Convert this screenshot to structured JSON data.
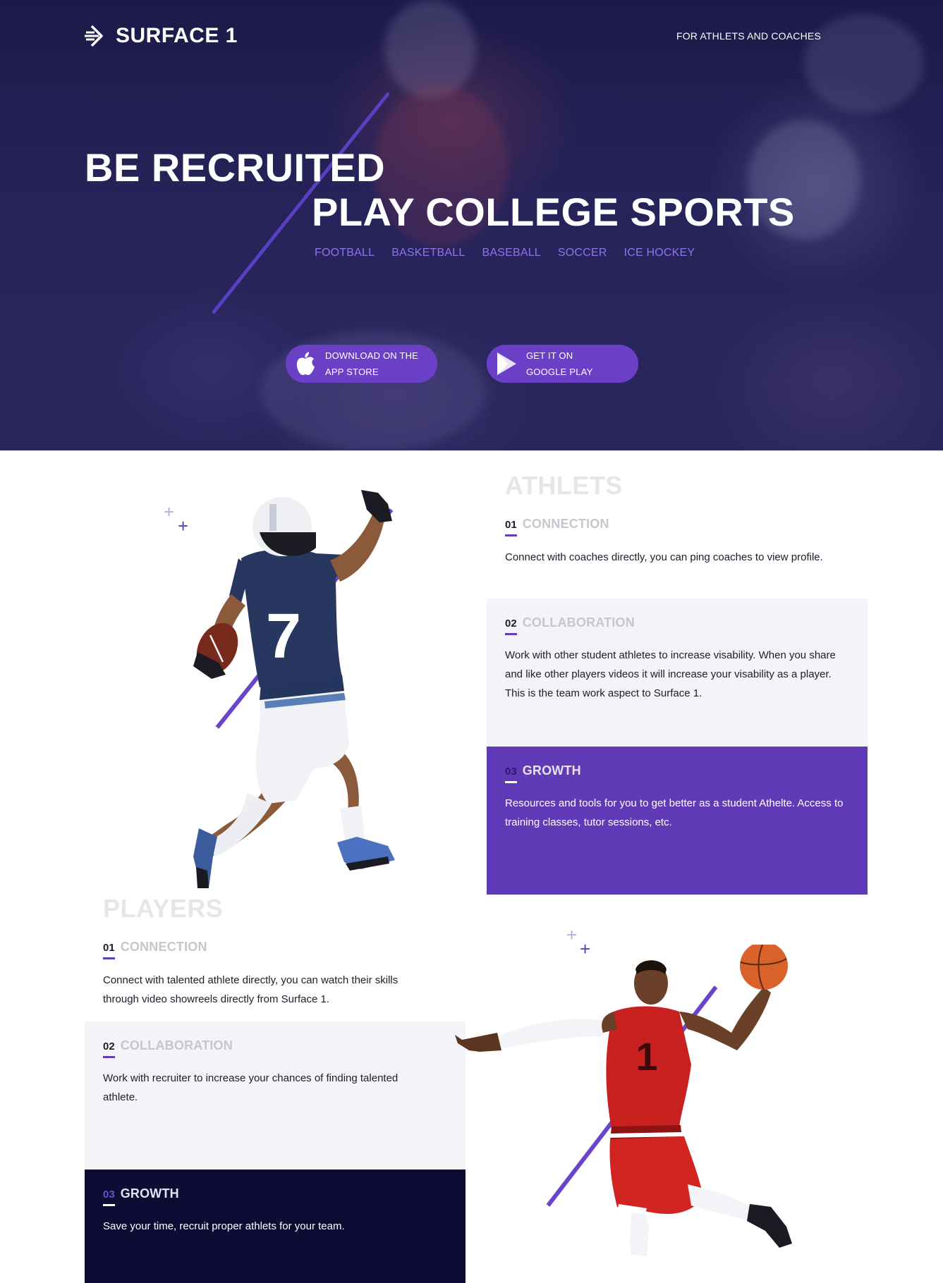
{
  "header": {
    "logo_text": "SURFACE 1",
    "top_link": "FOR ATHLETS AND COACHES"
  },
  "hero": {
    "line1": "BE RECRUITED",
    "line2": "PLAY COLLEGE SPORTS",
    "sports": [
      "FOOTBALL",
      "BASKETBALL",
      "BASEBALL",
      "SOCCER",
      "ICE HOCKEY"
    ],
    "appstore": {
      "line1": "DOWNLOAD ON THE",
      "line2": "APP STORE",
      "icon": "apple-icon"
    },
    "googleplay": {
      "line1": "GET IT ON",
      "line2": "GOOGLE PLAY",
      "icon": "play-icon"
    }
  },
  "athletes": {
    "title": "ATHLETS",
    "items": [
      {
        "num": "01",
        "label": "CONNECTION",
        "body": "Connect with coaches directly, you can ping coaches to view profile."
      },
      {
        "num": "02",
        "label": "COLLABORATION",
        "body": "Work with other student athletes to  increase visability. When you share and like other players videos it will increase your visability as a player. This is the team work aspect to Surface 1."
      },
      {
        "num": "03",
        "label": "GROWTH",
        "body": "Resources and tools for you to get better as a student Athelte. Access to training classes, tutor sessions, etc."
      }
    ]
  },
  "players": {
    "title": "PLAYERS",
    "items": [
      {
        "num": "01",
        "label": "CONNECTION",
        "body": "Connect with talented athlete directly, you can watch their skills through video showreels directly from Surface 1."
      },
      {
        "num": "02",
        "label": "COLLABORATION",
        "body": "Work with recruiter to increase your chances of finding talented athlete."
      },
      {
        "num": "03",
        "label": "GROWTH",
        "body": "Save your time, recruit proper athlets for your team."
      }
    ]
  },
  "images": {
    "football_jersey": "7",
    "basketball_jersey": "1"
  },
  "colors": {
    "accent": "#613ab8",
    "navy": "#0d0c34",
    "hero_bg": "#231f55",
    "sport_link": "#8f74ea",
    "light_panel": "#f4f3f8"
  }
}
